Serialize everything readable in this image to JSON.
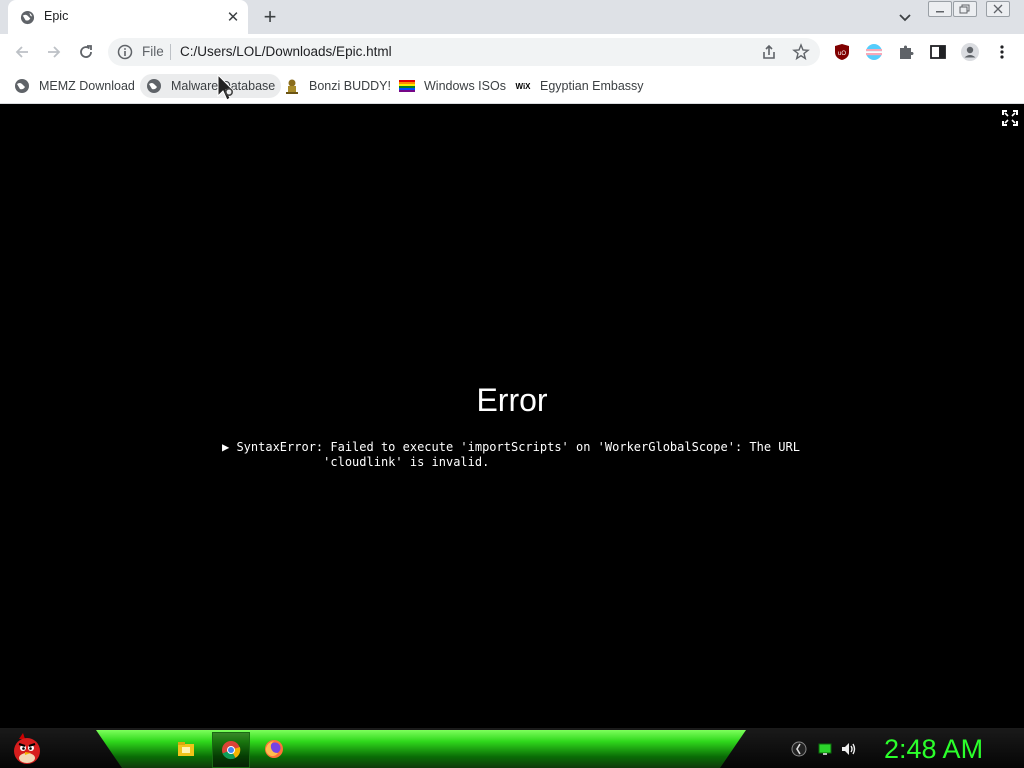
{
  "browser": {
    "tab": {
      "title": "Epic",
      "icon": "globe-icon"
    },
    "address_bar": {
      "scheme_label": "File",
      "url": "C:/Users/LOL/Downloads/Epic.html"
    },
    "bookmarks": [
      {
        "label": "MEMZ Download",
        "icon": "globe-icon"
      },
      {
        "label": "Malware Database",
        "icon": "globe-icon"
      },
      {
        "label": "Bonzi BUDDY!",
        "icon": "bonzi-icon"
      },
      {
        "label": "Windows ISOs",
        "icon": "rainbow-flag-icon"
      },
      {
        "label": "Egyptian Embassy",
        "icon": "wix-icon"
      }
    ],
    "extensions": [
      "ublock-icon",
      "flag-extension-icon",
      "puzzle-icon",
      "side-panel-icon",
      "profile-icon",
      "kebab-menu-icon"
    ]
  },
  "page": {
    "error_title": "Error",
    "error_message": "▶ SyntaxError: Failed to execute 'importScripts' on 'WorkerGlobalScope': The URL\n              'cloudlink' is invalid."
  },
  "taskbar": {
    "start_icon": "angry-bird-icon",
    "apps": [
      "file-explorer-icon",
      "chrome-icon",
      "firefox-icon"
    ],
    "active_app": "chrome-icon",
    "tray": [
      "tray-app-icon",
      "network-icon",
      "volume-icon"
    ],
    "clock": "2:48 AM",
    "clock_color": "#2bff2b"
  },
  "colors": {
    "accent_green": "#2fd81c",
    "tab_strip": "#dee1e6"
  }
}
